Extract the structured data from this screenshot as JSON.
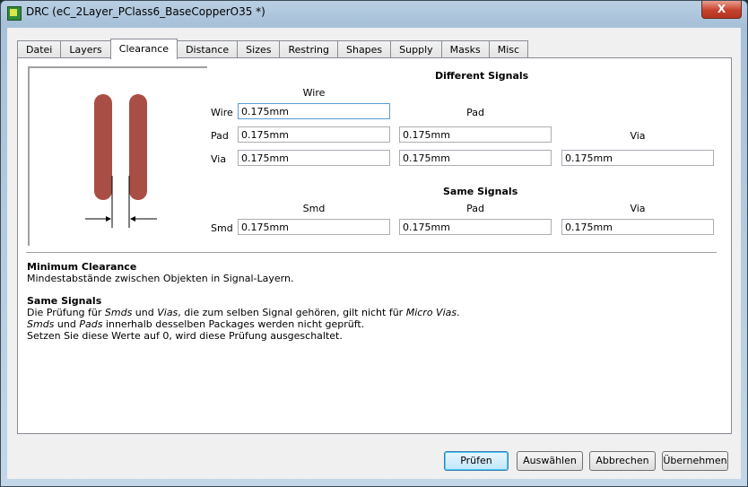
{
  "window": {
    "title": "DRC (eC_2Layer_PClass6_BaseCopperO35 *)",
    "close_glyph": "X"
  },
  "tabs": [
    "Datei",
    "Layers",
    "Clearance",
    "Distance",
    "Sizes",
    "Restring",
    "Shapes",
    "Supply",
    "Masks",
    "Misc"
  ],
  "active_tab": "Clearance",
  "different_signals": {
    "heading": "Different Signals",
    "col_wire": "Wire",
    "col_pad": "Pad",
    "col_via": "Via",
    "row_wire": "Wire",
    "row_pad": "Pad",
    "row_via": "Via",
    "wire_wire": "0.175mm",
    "pad_wire": "0.175mm",
    "pad_pad": "0.175mm",
    "via_wire": "0.175mm",
    "via_pad": "0.175mm",
    "via_via": "0.175mm"
  },
  "same_signals": {
    "heading": "Same Signals",
    "col_smd": "Smd",
    "col_pad": "Pad",
    "col_via": "Via",
    "row_smd": "Smd",
    "smd_smd": "0.175mm",
    "smd_pad": "0.175mm",
    "smd_via": "0.175mm"
  },
  "help": {
    "h1": "Minimum Clearance",
    "p1": "Mindestabstände zwischen Objekten in Signal-Layern.",
    "h2": "Same Signals",
    "l1_a": "Die Prüfung für ",
    "l1_b": "Smds",
    "l1_c": " und ",
    "l1_d": "Vias",
    "l1_e": ", die zum selben Signal gehören, gilt nicht für ",
    "l1_f": "Micro Vias",
    "l1_g": ".",
    "l2_a": "Smds",
    "l2_b": " und ",
    "l2_c": "Pads",
    "l2_d": " innerhalb desselben Packages werden nicht geprüft.",
    "l3": "Setzen Sie diese Werte auf 0, wird diese Prüfung ausgeschaltet."
  },
  "buttons": {
    "check": "Prüfen",
    "select": "Auswählen",
    "cancel": "Abbrechen",
    "apply": "Übernehmen"
  },
  "colors": {
    "trace": "#a94e45",
    "panel": "#ffffff",
    "dialog": "#f0f0f0",
    "titlebar": "#b9cfe3"
  }
}
